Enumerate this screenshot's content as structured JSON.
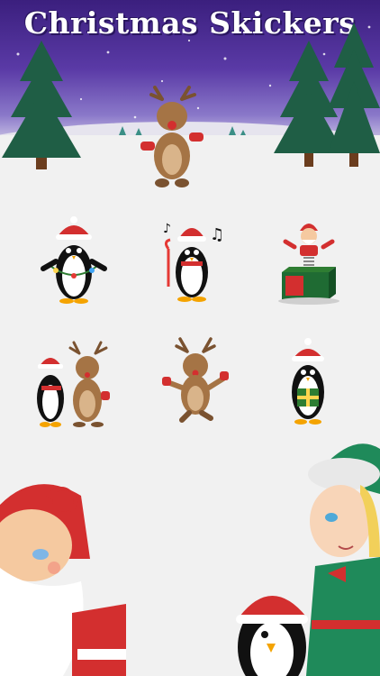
{
  "app": {
    "title": "Christmas Skickers"
  },
  "colors": {
    "sky_top": "#3b1f7e",
    "sky_bottom": "#8a78c9",
    "tree": "#1f5e45",
    "santa_red": "#d32f2f",
    "elf_green": "#1f8a5a"
  },
  "stickers": [
    {
      "name": "penguin-lights"
    },
    {
      "name": "penguin-music"
    },
    {
      "name": "santa-jack-in-the-box"
    },
    {
      "name": "penguin-and-reindeer"
    },
    {
      "name": "reindeer-dancing"
    },
    {
      "name": "penguin-with-gift"
    }
  ]
}
